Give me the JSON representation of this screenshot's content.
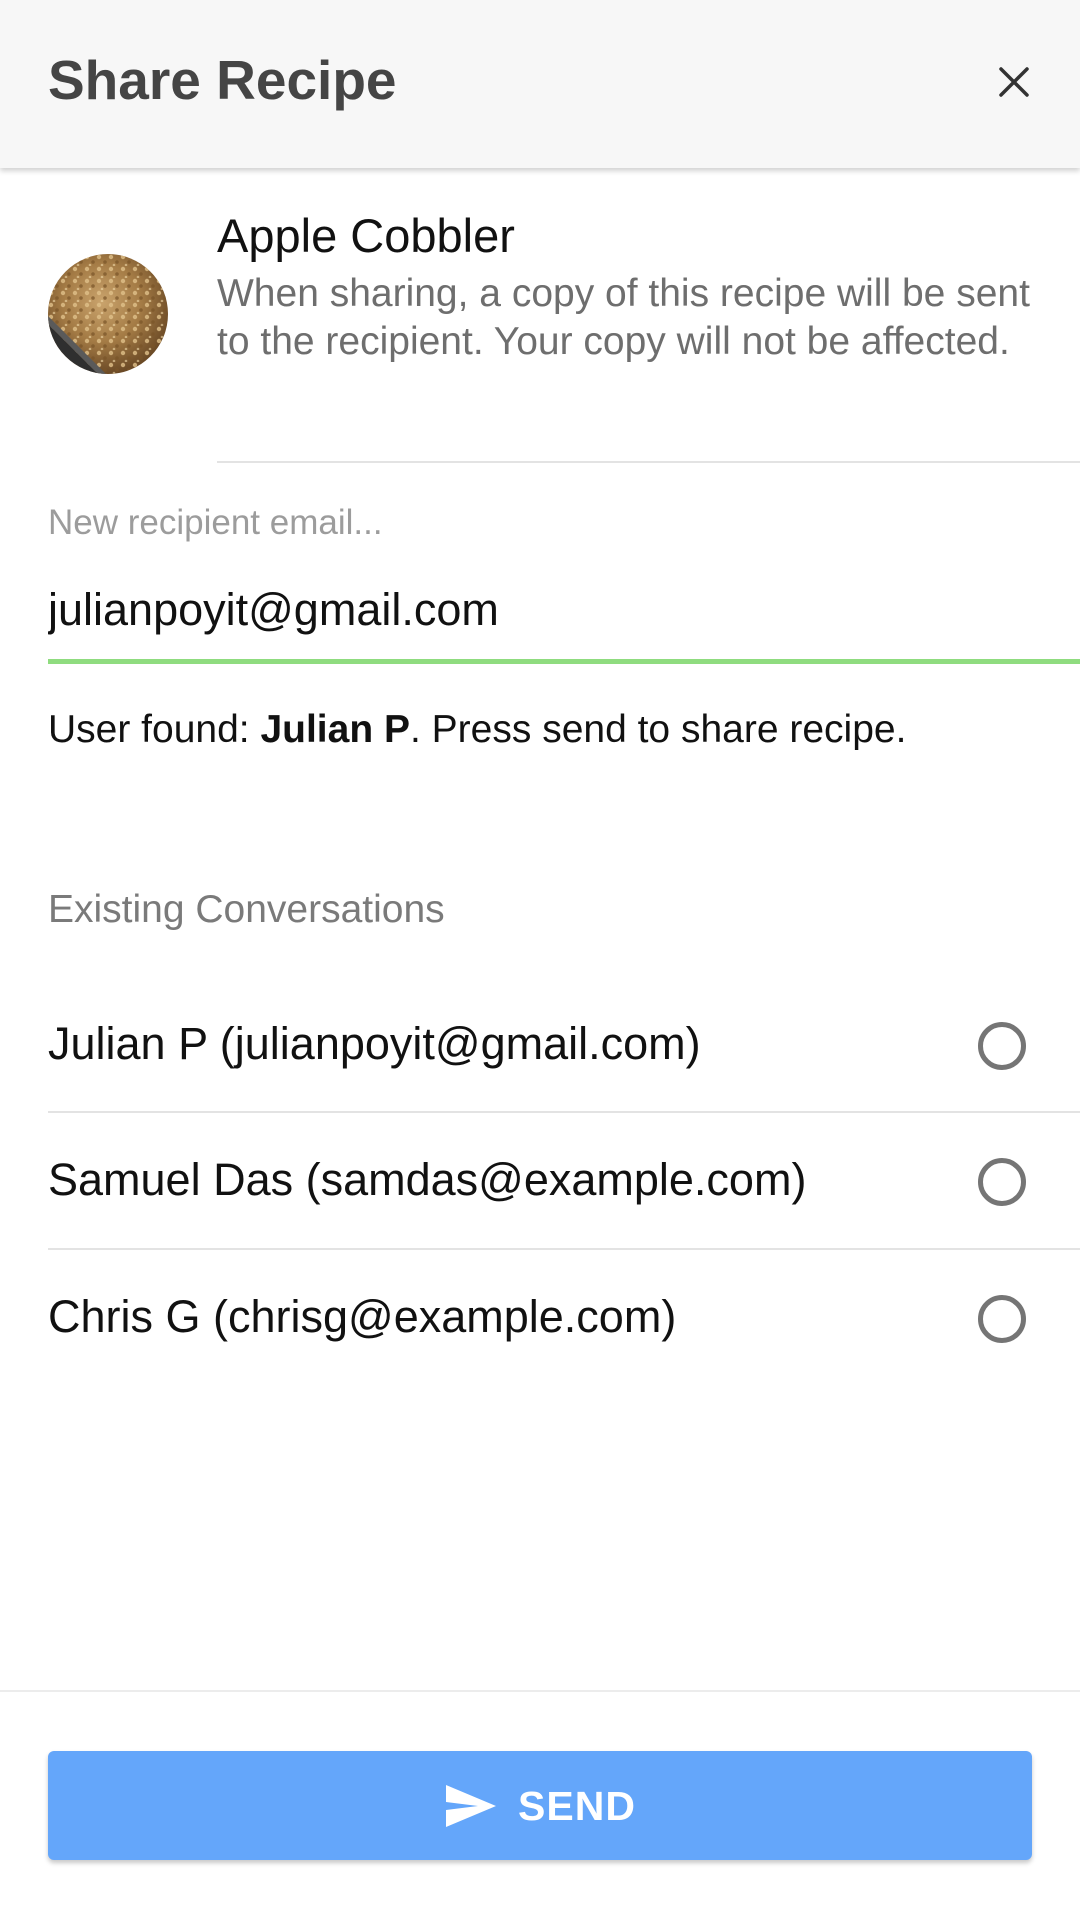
{
  "header": {
    "title": "Share Recipe",
    "close_icon": "close-icon"
  },
  "recipe": {
    "title": "Apple Cobbler",
    "description": "When sharing, a copy of this recipe will be sent to the recipient. Your copy will not be affected.",
    "thumbnail": "apple-cobbler-photo"
  },
  "email_field": {
    "placeholder": "New recipient email...",
    "value": "julianpoyit@gmail.com",
    "underline_color": "#8fdc7f"
  },
  "user_found": {
    "prefix": "User found: ",
    "name": "Julian P",
    "suffix": ". Press send to share recipe."
  },
  "conversations": {
    "label": "Existing Conversations",
    "items": [
      {
        "label": "Julian P (julianpoyit@gmail.com)",
        "selected": false
      },
      {
        "label": "Samuel Das (samdas@example.com)",
        "selected": false
      },
      {
        "label": "Chris G (chrisg@example.com)",
        "selected": false
      }
    ]
  },
  "send_button": {
    "label": "SEND",
    "icon": "send-icon",
    "color": "#64a6fa"
  }
}
